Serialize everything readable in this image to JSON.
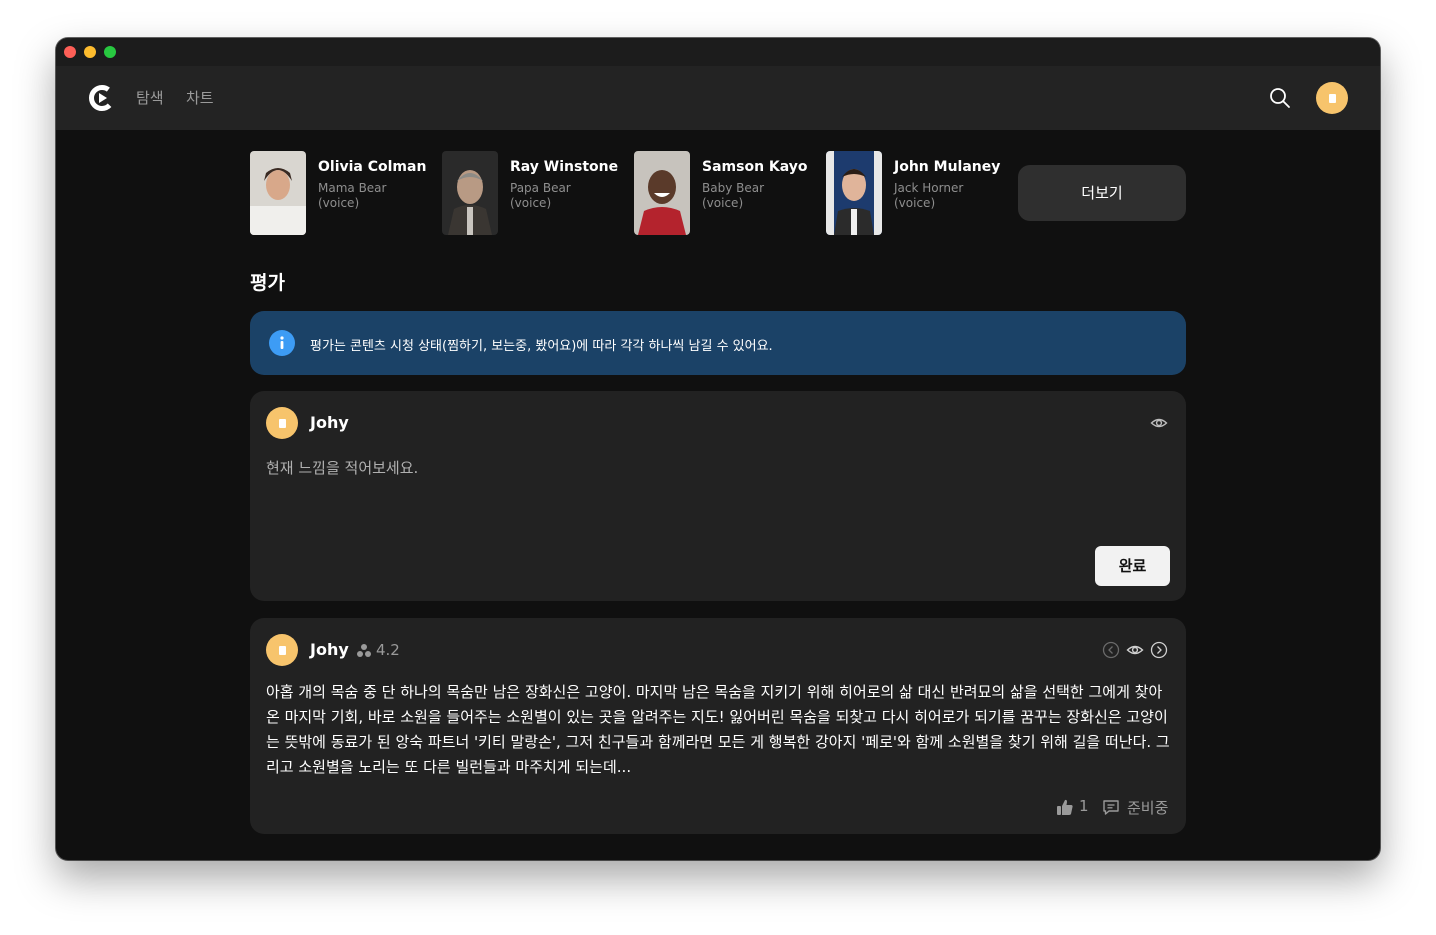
{
  "window": {
    "traffic_lights": [
      "close",
      "minimize",
      "zoom"
    ]
  },
  "navbar": {
    "logo_icon": "play-logo-icon",
    "links": [
      {
        "label": "탐색"
      },
      {
        "label": "차트"
      }
    ],
    "search_icon": "search-icon"
  },
  "cast": [
    {
      "name": "Olivia Colman",
      "role_line1": "Mama Bear",
      "role_line2": "(voice)"
    },
    {
      "name": "Ray Winstone",
      "role_line1": "Papa Bear",
      "role_line2": "(voice)"
    },
    {
      "name": "Samson Kayo",
      "role_line1": "Baby Bear",
      "role_line2": "(voice)"
    },
    {
      "name": "John Mulaney",
      "role_line1": "Jack Horner",
      "role_line2": "(voice)"
    }
  ],
  "more_button": "더보기",
  "section_title": "평가",
  "notice": {
    "icon": "info-icon",
    "text": "평가는 콘텐츠 시청 상태(찜하기, 보는중, 봤어요)에 따라 각각 하나씩 남길 수 있어요."
  },
  "compose": {
    "user": "Johy",
    "placeholder": "현재 느낌을 적어보세요.",
    "submit_label": "완료"
  },
  "review": {
    "user": "Johy",
    "rating": "4.2",
    "text": "아홉 개의 목숨 중 단 하나의 목숨만 남은 장화신은 고양이. 마지막 남은 목숨을 지키기 위해 히어로의 삶 대신 반려묘의 삶을 선택한 그에게 찾아온 마지막 기회, 바로 소원을 들어주는 소원별이 있는 곳을 알려주는 지도! 잃어버린 목숨을 되찾고 다시 히어로가 되기를 꿈꾸는 장화신은 고양이는 뜻밖에 동료가 된 앙숙 파트너 '키티 말랑손', 그저 친구들과 함께라면 모든 게 행복한 강아지 '페로'와 함께 소원별을 찾기 위해 길을 떠난다. 그리고 소원별을 노리는 또 다른 빌런들과 마주치게 되는데...",
    "like_count": "1",
    "comment_label": "준비중"
  },
  "colors": {
    "background": "#101010",
    "navbar": "#232323",
    "card": "#222222",
    "notice": "#1b4267",
    "avatar": "#f7c46c",
    "info_accent": "#3d9cf5"
  }
}
